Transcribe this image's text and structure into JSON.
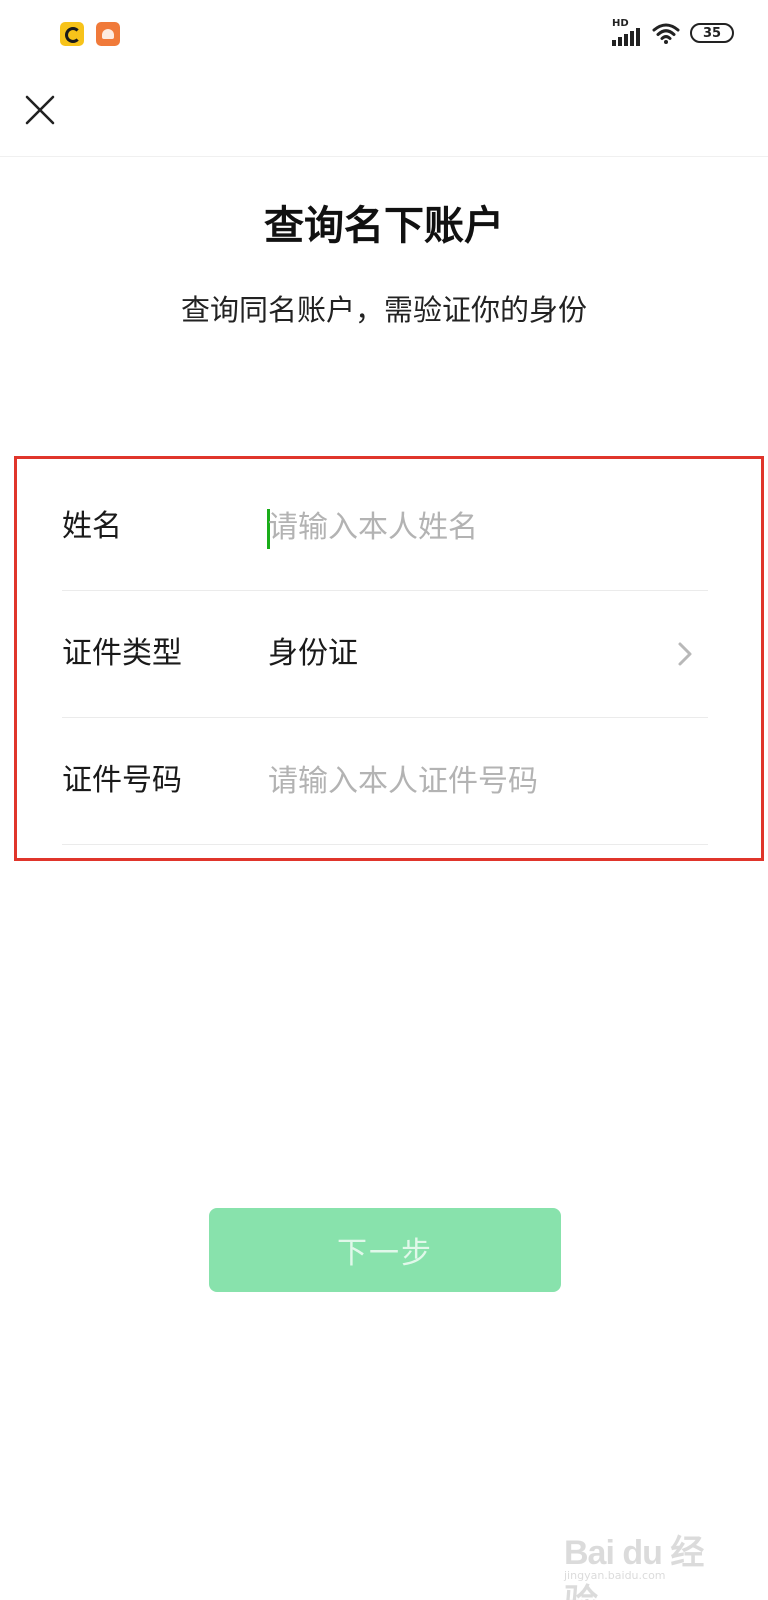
{
  "status_bar": {
    "app_icons": [
      "qq-browser-icon",
      "uc-browser-icon"
    ],
    "network_label": "HD",
    "battery_level": "35"
  },
  "nav": {
    "close_icon": "close-icon"
  },
  "header": {
    "title": "查询名下账户",
    "subtitle": "查询同名账户，需验证你的身份"
  },
  "form": {
    "name_label": "姓名",
    "name_placeholder": "请输入本人姓名",
    "name_value": "",
    "id_type_label": "证件类型",
    "id_type_value": "身份证",
    "id_number_label": "证件号码",
    "id_number_placeholder": "请输入本人证件号码",
    "id_number_value": ""
  },
  "actions": {
    "next_label": "下一步"
  },
  "colors": {
    "accent_green": "#1aad19",
    "button_disabled": "#88e2ac",
    "highlight_red": "#e0352b",
    "placeholder": "#b3b3b3"
  }
}
